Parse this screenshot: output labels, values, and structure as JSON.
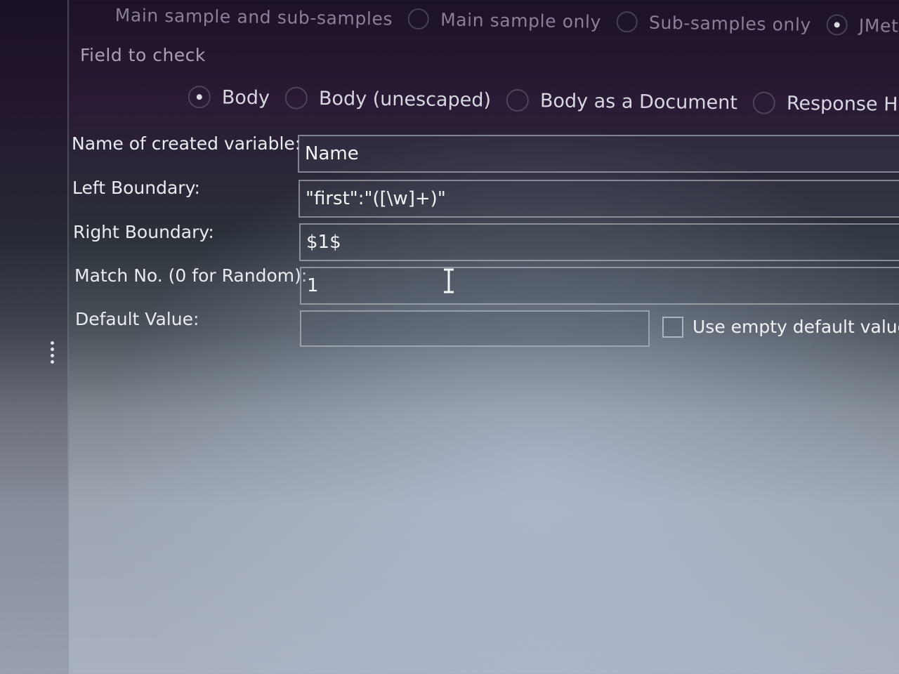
{
  "sample_scope": {
    "options": [
      {
        "label": "Main sample and sub-samples",
        "selected": false
      },
      {
        "label": "Main sample only",
        "selected": false
      },
      {
        "label": "Sub-samples only",
        "selected": false
      },
      {
        "label": "JMeter Variab",
        "selected": true
      }
    ]
  },
  "field_to_check": {
    "label": "Field to check",
    "options": [
      {
        "label": "Body",
        "selected": true
      },
      {
        "label": "Body (unescaped)",
        "selected": false
      },
      {
        "label": "Body as a Document",
        "selected": false
      },
      {
        "label": "Response Headers",
        "selected": false
      }
    ]
  },
  "form": {
    "variable_name": {
      "label": "Name of created variable:",
      "value": "Name"
    },
    "left_boundary": {
      "label": "Left Boundary:",
      "value": "\"first\":\"([\\w]+)\""
    },
    "right_boundary": {
      "label": "Right Boundary:",
      "value": "$1$"
    },
    "match_no": {
      "label": "Match No. (0 for Random):",
      "value": "1"
    },
    "default_value": {
      "label": "Default Value:",
      "value": ""
    },
    "use_empty_default": {
      "label": "Use empty default value",
      "checked": false
    }
  }
}
